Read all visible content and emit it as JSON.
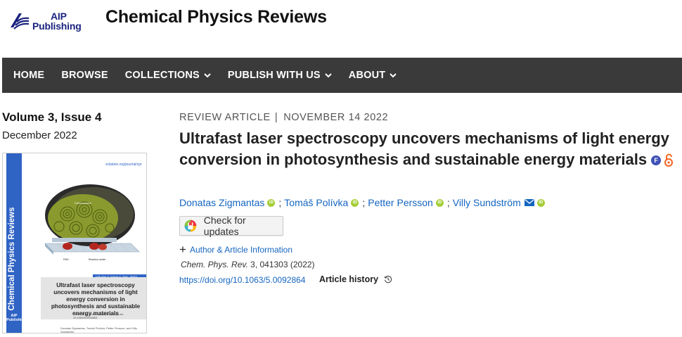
{
  "header": {
    "logo_line1": "AIP",
    "logo_line2": "Publishing",
    "journal_title": "Chemical Physics Reviews"
  },
  "nav": {
    "items": [
      {
        "label": "HOME",
        "has_dropdown": false
      },
      {
        "label": "BROWSE",
        "has_dropdown": false
      },
      {
        "label": "COLLECTIONS",
        "has_dropdown": true
      },
      {
        "label": "PUBLISH WITH US",
        "has_dropdown": true
      },
      {
        "label": "ABOUT",
        "has_dropdown": true
      }
    ]
  },
  "issue": {
    "volume": "Volume 3, Issue 4",
    "date": "December 2022",
    "cover": {
      "band_text": "Chemical Physics Reviews",
      "url": "scitation.org/journal/cpr",
      "issue_label": "Volume 3, Issue 4, Dec. 2022",
      "title": "Ultrafast laser spectroscopy uncovers mechanisms of light energy conversion in photosynthesis and sustainable energy materials",
      "citation": "Chem. Phys. Rev. 3, 041303 (2022); doi: 10.1063/5.0092864",
      "authors": "Donatas Zigmantas, Tomáš Polívka, Petter Persson, and Villy Sundström",
      "logo_line1": "AIP",
      "logo_line2": "Publishing",
      "art_label_top": "Chlorosomes",
      "art_label_left": "FMO",
      "art_label_right": "Reaction center"
    }
  },
  "article": {
    "type": "REVIEW ARTICLE",
    "separator": "|",
    "date": "NOVEMBER 14 2022",
    "title": "Ultrafast laser spectroscopy uncovers mechanisms of light energy conversion in photosynthesis and sustainable energy materials",
    "free_badge": "F",
    "authors": [
      {
        "name": "Donatas Zigmantas",
        "orcid": true,
        "email": false
      },
      {
        "name": "Tomáš Polívka",
        "orcid": true,
        "email": false
      },
      {
        "name": "Petter Persson",
        "orcid": true,
        "email": false
      },
      {
        "name": "Villy Sundström",
        "orcid": true,
        "email": true
      }
    ],
    "author_sep": ";",
    "check_updates_label": "Check for updates",
    "author_info_label": "Author & Article Information",
    "citation_journal": "Chem. Phys. Rev.",
    "citation_rest": " 3, 041303 (2022)",
    "doi": "https://doi.org/10.1063/5.0092864",
    "history_label": "Article history"
  },
  "colors": {
    "nav_bg": "#3a3a3a",
    "link": "#1565c0",
    "orcid": "#a6ce39",
    "cover_band": "#2f63c4",
    "logo": "#1a237e",
    "open_access": "#f26522"
  }
}
